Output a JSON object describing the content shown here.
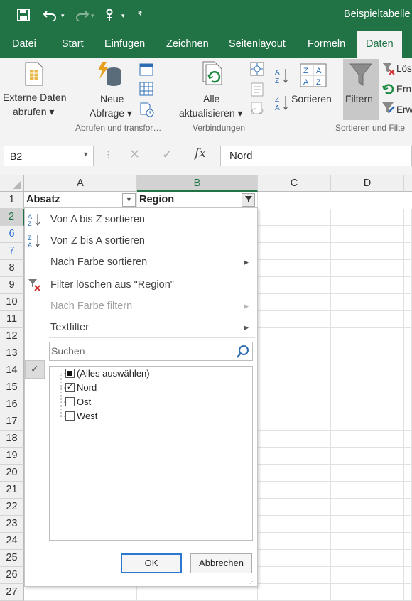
{
  "title_bar": {
    "doc_title": "Beispieltabelle"
  },
  "tabs": [
    "Datei",
    "Start",
    "Einfügen",
    "Zeichnen",
    "Seitenlayout",
    "Formeln",
    "Daten"
  ],
  "active_tab": "Daten",
  "ribbon": {
    "external_data": [
      "Externe Daten",
      "abrufen ▾"
    ],
    "new_query": [
      "Neue",
      "Abfrage ▾"
    ],
    "refresh_all": [
      "Alle",
      "aktualisieren ▾"
    ],
    "sort_label": "Sortieren",
    "filter_label": "Filtern",
    "clear_label": "Lös",
    "reapply_label": "Ern",
    "advanced_label": "Erw",
    "group_get_transform": "Abrufen und transfor…",
    "group_connections": "Verbindungen",
    "group_sort_filter": "Sortieren und Filte"
  },
  "formula_bar": {
    "name_box": "B2",
    "fx": "fx",
    "value": "Nord"
  },
  "columns": [
    "A",
    "B",
    "C",
    "D"
  ],
  "rows": [
    "1",
    "2",
    "6",
    "7",
    "8",
    "9",
    "10",
    "11",
    "12",
    "13",
    "14",
    "15",
    "16",
    "17",
    "18",
    "19",
    "20",
    "21",
    "22",
    "23",
    "24",
    "25",
    "26",
    "27"
  ],
  "cells": {
    "A1": "Absatz",
    "B1": "Region"
  },
  "filter_menu": {
    "sort_az": "Von A bis Z sortieren",
    "sort_za": "Von Z bis A sortieren",
    "sort_by_color": "Nach Farbe sortieren",
    "clear_filter": "Filter löschen aus \"Region\"",
    "filter_by_color": "Nach Farbe filtern",
    "text_filter": "Textfilter",
    "search_placeholder": "Suchen",
    "items": [
      {
        "label": "(Alles auswählen)",
        "state": "partial"
      },
      {
        "label": "Nord",
        "state": "checked"
      },
      {
        "label": "Ost",
        "state": "unchecked"
      },
      {
        "label": "West",
        "state": "unchecked"
      }
    ],
    "ok": "OK",
    "cancel": "Abbrechen"
  },
  "colors": {
    "excel_green": "#217346",
    "accent_blue": "#2b78d0",
    "row_blue": "#2b6cd3"
  }
}
